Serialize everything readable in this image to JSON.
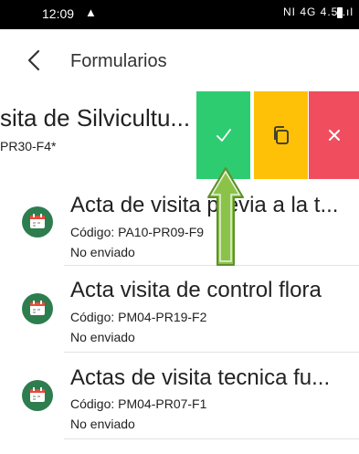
{
  "status_bar": {
    "time": "12:09",
    "alert_icon": "▲",
    "right_indicators": "NI 4G 4.5 .ıl",
    "battery_icon": "battery-icon"
  },
  "app_bar": {
    "back_icon": "chevron-left-icon",
    "title": "Formularios"
  },
  "swiped_row": {
    "title": "sita de Silvicultu...",
    "code": "PR30-F4*",
    "actions": [
      {
        "name": "confirm",
        "icon": "check-icon",
        "color": "#2ecc71"
      },
      {
        "name": "copy",
        "icon": "copy-icon",
        "color": "#ffc107"
      },
      {
        "name": "delete",
        "icon": "close-icon",
        "color": "#f04e5e"
      }
    ]
  },
  "list": {
    "items": [
      {
        "title": "Acta de visita previa a la t...",
        "code": "Código: PA10-PR09-F9",
        "status": "No enviado",
        "icon": "calendar-icon"
      },
      {
        "title": "Acta visita de control flora",
        "code": "Código: PM04-PR19-F2",
        "status": "No enviado",
        "icon": "calendar-icon"
      },
      {
        "title": "Actas de visita tecnica fu...",
        "code": "Código: PM04-PR07-F1",
        "status": "No enviado",
        "icon": "calendar-icon"
      }
    ]
  },
  "annotation": {
    "icon": "up-arrow-icon",
    "color": "#8bc34a"
  }
}
